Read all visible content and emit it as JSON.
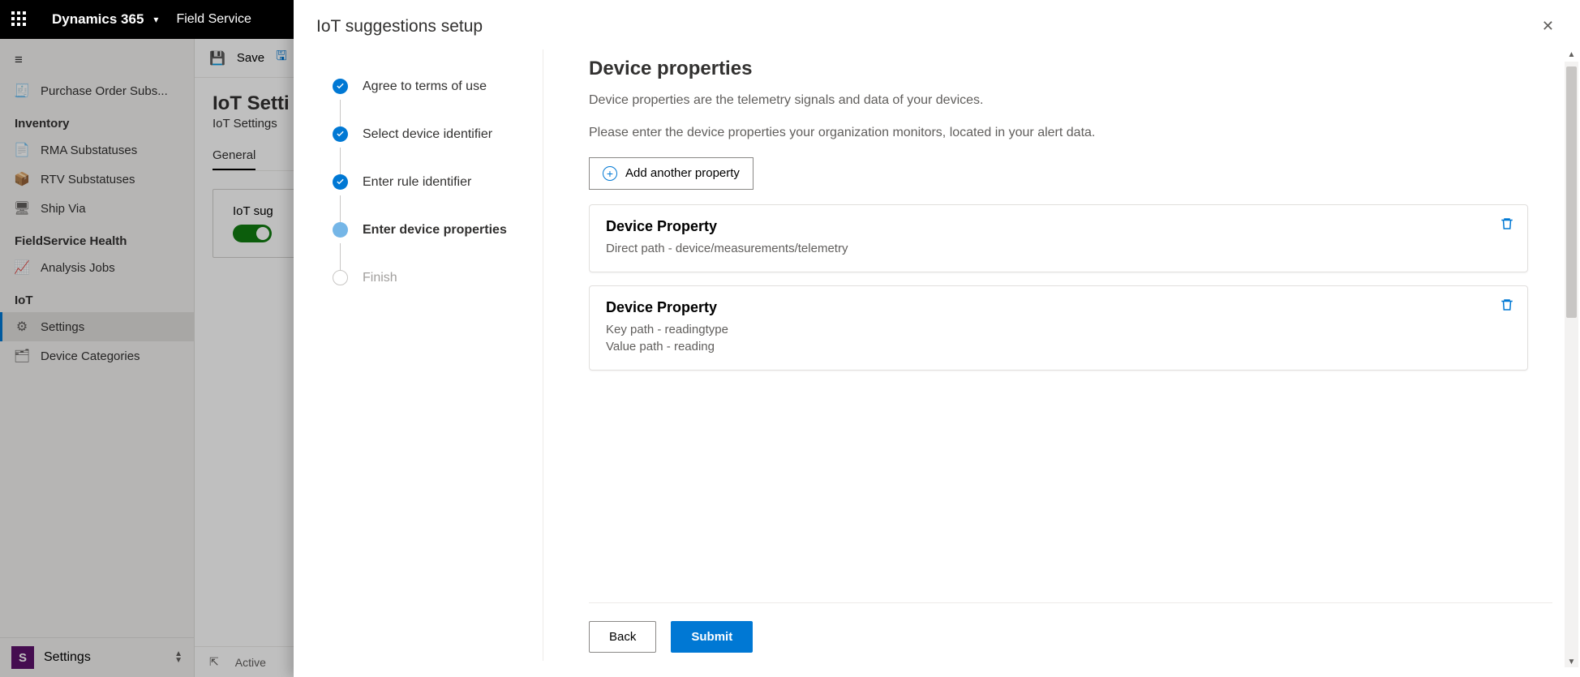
{
  "topbar": {
    "brand": "Dynamics 365",
    "app": "Field Service"
  },
  "nav": {
    "items_top": [
      {
        "icon": "receipt",
        "label": "Purchase Order Subs..."
      }
    ],
    "group_inventory": "Inventory",
    "inventory_items": [
      {
        "label": "RMA Substatuses"
      },
      {
        "label": "RTV Substatuses"
      },
      {
        "label": "Ship Via"
      }
    ],
    "group_health": "FieldService Health",
    "health_items": [
      {
        "label": "Analysis Jobs"
      }
    ],
    "group_iot": "IoT",
    "iot_items": [
      {
        "label": "Settings",
        "active": true
      },
      {
        "label": "Device Categories"
      }
    ],
    "footer_tile": "S",
    "footer_label": "Settings"
  },
  "commandbar": {
    "save": "Save"
  },
  "page": {
    "title": "IoT Setti",
    "subtitle": "IoT Settings",
    "tab_general": "General",
    "card_label": "IoT sug"
  },
  "statusbar": {
    "state": "Active"
  },
  "panel": {
    "title": "IoT suggestions setup",
    "steps": [
      {
        "label": "Agree to terms of use",
        "state": "done"
      },
      {
        "label": "Select device identifier",
        "state": "done"
      },
      {
        "label": "Enter rule identifier",
        "state": "done"
      },
      {
        "label": "Enter device properties",
        "state": "current"
      },
      {
        "label": "Finish",
        "state": "pending"
      }
    ],
    "heading": "Device properties",
    "desc1": "Device properties are the telemetry signals and data of your devices.",
    "desc2": "Please enter the device properties your organization monitors, located in your alert data.",
    "add_label": "Add another property",
    "properties": [
      {
        "title": "Device Property",
        "lines": [
          "Direct path - device/measurements/telemetry"
        ]
      },
      {
        "title": "Device Property",
        "lines": [
          "Key path - readingtype",
          "Value path - reading"
        ]
      }
    ],
    "back": "Back",
    "submit": "Submit"
  }
}
